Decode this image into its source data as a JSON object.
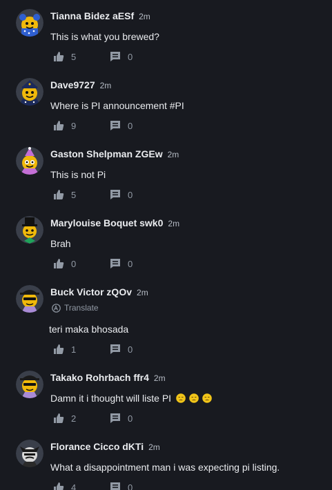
{
  "comments": [
    {
      "name": "Tianna Bidez aESf",
      "time": "2m",
      "text": "This is what you brewed?",
      "likes": "5",
      "replies": "0",
      "avatar": "blue-bear-icon"
    },
    {
      "name": "Dave9727",
      "time": "2m",
      "text": "Where is PI announcement #PI",
      "likes": "9",
      "replies": "0",
      "avatar": "navy-captain-icon"
    },
    {
      "name": "Gaston Shelpman ZGEw",
      "time": "2m",
      "text": "This is not Pi",
      "likes": "5",
      "replies": "0",
      "avatar": "party-hat-icon"
    },
    {
      "name": "Marylouise Boquet swk0",
      "time": "2m",
      "text": "Brah",
      "likes": "0",
      "replies": "0",
      "avatar": "top-hat-icon"
    },
    {
      "name": "Buck Victor zQOv",
      "time": "2m",
      "translate": "Translate",
      "text": "teri maka bhosada",
      "likes": "1",
      "replies": "0",
      "avatar": "gangster-icon"
    },
    {
      "name": "Takako Rohrbach ffr4",
      "time": "2m",
      "text": "Damn it i thought will liste PI",
      "likes": "2",
      "replies": "0",
      "avatar": "gangster-icon"
    },
    {
      "name": "Florance Cicco dKTi",
      "time": "2m",
      "text": "What a disappointment man i was expecting pi listing.",
      "likes": "4",
      "replies": "0",
      "avatar": "samurai-icon"
    }
  ],
  "emoji": "unamused-face-icon",
  "colors": {
    "background": "#181a20",
    "text": "#eaecef",
    "muted": "#929aa5",
    "avatar_yellow": "#f0b90b"
  }
}
